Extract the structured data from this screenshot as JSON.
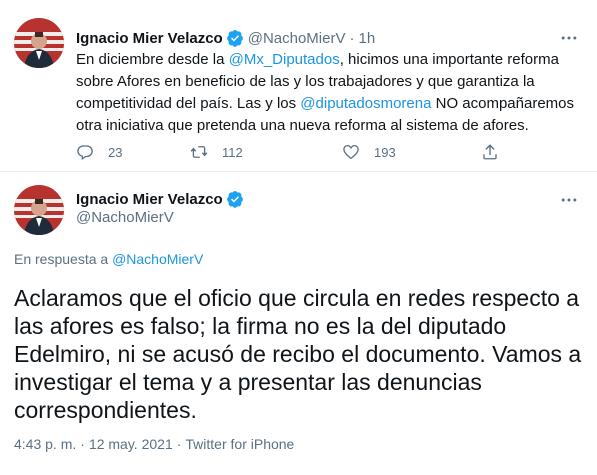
{
  "tweet1": {
    "author_name": "Ignacio Mier Velazco",
    "handle": "@NachoMierV",
    "separator": "·",
    "time": "1h",
    "body": {
      "line1_pre": "En diciembre desde la ",
      "line1_mention": "@Mx_Diputados",
      "line1_post": ", hicimos una importante reforma",
      "line2": "sobre Afores en beneficio de las y los trabajadores y que garantiza la",
      "line3_pre": "competitividad del país. Las y los ",
      "line3_mention": "@diputadosmorena",
      "line3_post": " NO acompañaremos",
      "line4": "otra iniciativa que pretenda una nueva reforma al sistema de afores."
    },
    "actions": {
      "reply_count": "23",
      "retweet_count": "112",
      "like_count": "193"
    }
  },
  "tweet2": {
    "author_name": "Ignacio Mier Velazco",
    "handle": "@NachoMierV",
    "reply_prefix": "En respuesta a ",
    "reply_handle": "@NachoMierV",
    "body_lines": [
      "Aclaramos que el oficio que circula en redes respecto a",
      "las afores es falso; la firma no es la del diputado",
      "Edelmiro, ni se acusó de recibo el documento. Vamos a",
      "investigar el tema y a presentar las denuncias",
      "correspondientes."
    ],
    "meta": {
      "time": "4:43 p. m.",
      "separator": "·",
      "date": "12 may. 2021",
      "separator2": "·",
      "source": "Twitter for iPhone"
    }
  },
  "colors": {
    "link": "#1b95e0",
    "verified": "#1da1f2",
    "secondary_text": "#5b7083",
    "primary_text": "#0f1419",
    "divider": "#e6ecf0"
  },
  "icons": [
    "avatar",
    "verified-badge-icon",
    "more-options-icon",
    "reply-icon",
    "retweet-icon",
    "like-icon",
    "share-icon"
  ]
}
